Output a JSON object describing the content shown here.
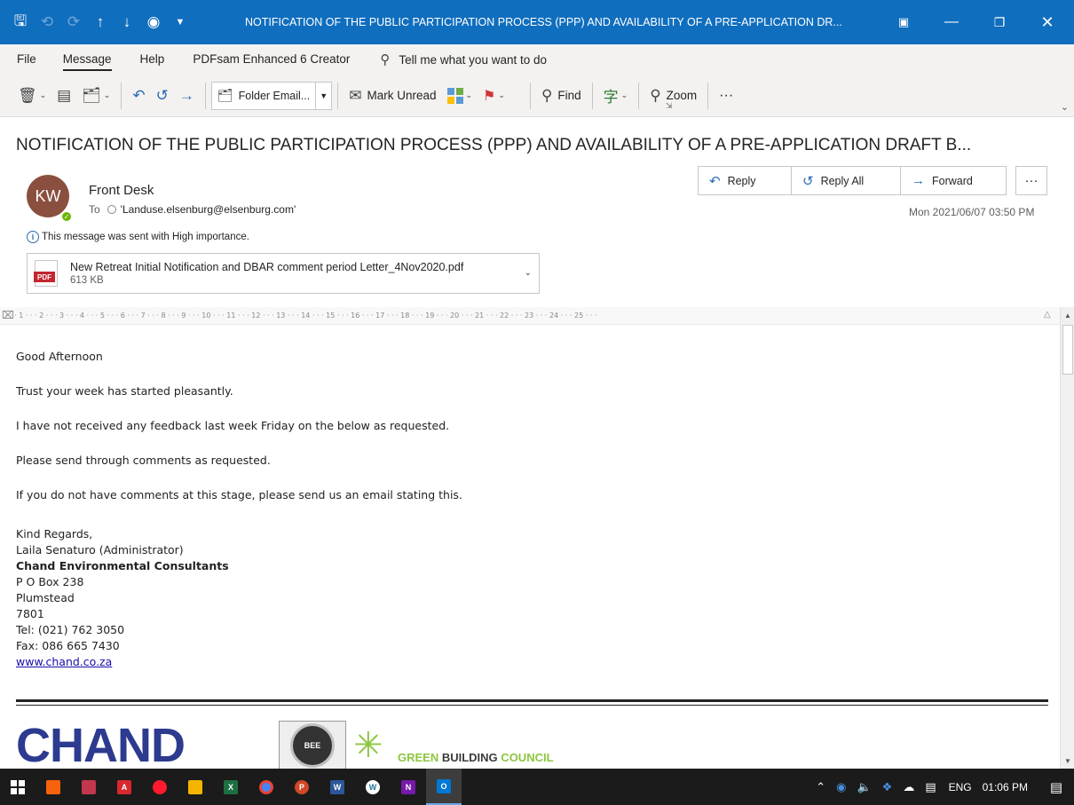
{
  "window": {
    "title": "NOTIFICATION OF THE PUBLIC PARTICIPATION PROCESS (PPP) AND AVAILABILITY OF A PRE-APPLICATION DR...",
    "quick_access": [
      "save-icon",
      "undo-icon",
      "redo-icon",
      "up-icon",
      "down-icon",
      "record-icon",
      "customize-icon"
    ],
    "controls": [
      "restore-ribbon-icon",
      "minimize-icon",
      "maximize-icon",
      "close-icon"
    ]
  },
  "menu": {
    "items": [
      "File",
      "Message",
      "Help",
      "PDFsam Enhanced 6 Creator"
    ],
    "active": "Message",
    "tell_me": "Tell me what you want to do"
  },
  "ribbon": {
    "folder_email": "Folder Email...",
    "mark_unread": "Mark Unread",
    "find": "Find",
    "zoom": "Zoom",
    "more": "···"
  },
  "message": {
    "subject": "NOTIFICATION OF THE PUBLIC PARTICIPATION PROCESS (PPP) AND AVAILABILITY OF A PRE-APPLICATION DRAFT B...",
    "avatar_initials": "KW",
    "sender": "Front Desk",
    "to_label": "To",
    "to_address": "'Landuse.elsenburg@elsenburg.com'",
    "date": "Mon 2021/06/07 03:50 PM",
    "importance": "This message was sent with High importance.",
    "actions": {
      "reply": "Reply",
      "reply_all": "Reply All",
      "forward": "Forward",
      "more": "···"
    },
    "attachment": {
      "badge": "PDF",
      "name": "New Retreat Initial Notification and DBAR comment period Letter_4Nov2020.pdf",
      "size": "613 KB"
    }
  },
  "ruler": {
    "text": "· · · 1 · · · 2 · · · 3 · · · 4 · · · 5 · · · 6 · · · 7 · · · 8 · · · 9 · · · 10 · · · 11 · · · 12 · · · 13 · · · 14 · · · 15 · · · 16 · · · 17 · · · 18 · · · 19 · · · 20 · · · 21 · · · 22 · · · 23 · · · 24 · · · 25 · · ·"
  },
  "body": {
    "paragraphs": [
      "Good Afternoon",
      "Trust your week has started pleasantly.",
      "I have not received any feedback last week Friday on the below as requested.",
      "Please send through comments as requested.",
      "If you do not have comments at this stage, please send us an email stating this."
    ],
    "signature": {
      "closing": "Kind Regards,",
      "name": "Laila Senaturo (Administrator)",
      "company": "Chand Environmental Consultants",
      "address1": "P O Box 238",
      "address2": "Plumstead",
      "postal": "7801",
      "tel": "Tel:  (021) 762 3050",
      "fax": "Fax: 086 665 7430",
      "website": "www.chand.co.za"
    },
    "logos": {
      "chand": "CHAND",
      "bee": "BEE",
      "gbc_green": "GREEN ",
      "gbc_bold": "BUILDING",
      "gbc_rest": " COUNCIL"
    }
  },
  "taskbar": {
    "apps": [
      "windows-start",
      "app-orange",
      "snipping-tool",
      "acrobat",
      "opera",
      "file-explorer",
      "excel",
      "chrome",
      "powerpoint",
      "word",
      "wordpress",
      "onenote",
      "outlook"
    ],
    "language": "ENG",
    "time": "01:06 PM"
  },
  "colors": {
    "titlebar": "#106ebe",
    "accent": "#2b6cb3",
    "ribbon_bg": "#f3f2f1",
    "taskbar": "#1b1b1b"
  }
}
